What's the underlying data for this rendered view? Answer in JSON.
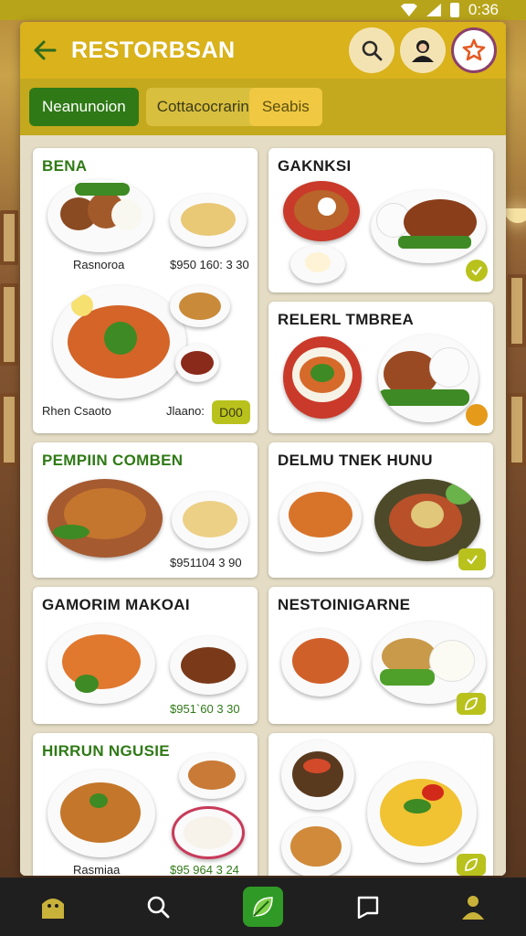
{
  "status_bar": {
    "time": "0:36"
  },
  "app_bar": {
    "title": "RESTORBSAN"
  },
  "tabs": [
    {
      "label": "Neanunoion"
    },
    {
      "label": "Cottacocrarin"
    },
    {
      "label": "Seabis"
    }
  ],
  "cards": [
    {
      "title": "BENA",
      "labels": [
        "Rasnoroa",
        "$950 160: 3 30",
        "Rhen Csaoto",
        "Jlaano:"
      ],
      "badge": "D00"
    },
    {
      "title": "GAKNKSI"
    },
    {
      "title": "RELERL TMBREA"
    },
    {
      "title": "PEMPIIN COMBEN",
      "price": "$951104 3 90"
    },
    {
      "title": "DELMU TNEK HUNU"
    },
    {
      "title": "GAMORIM MAKOAI",
      "price": "$951`60 3 30"
    },
    {
      "title": "NESTOINIGARNE"
    },
    {
      "title": "HIRRUN NGUSIE",
      "label": "Rasmiaa",
      "price": "$95 964 3 24"
    },
    {
      "title": ""
    }
  ],
  "colors": {
    "app_bar": "#d9b21c",
    "tab_active": "#2f7a16",
    "accent_green": "#2f7a16",
    "nav_bg": "#1f1f1f"
  },
  "icons": {
    "back": "arrow-left-icon",
    "search": "search-icon",
    "avatar": "person-icon",
    "profile": "star-icon",
    "nav": [
      "home-icon",
      "search-icon",
      "leaf-icon",
      "chat-icon",
      "person-icon"
    ]
  }
}
